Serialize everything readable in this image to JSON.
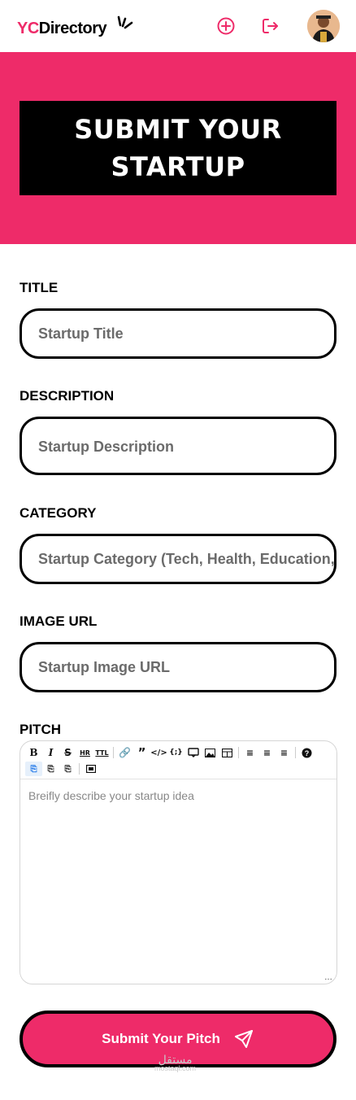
{
  "brand": {
    "yc": "YC",
    "directory": "Directory"
  },
  "colors": {
    "primary": "#EE2B69",
    "black": "#000000"
  },
  "nav": {
    "create_icon": "plus-circle-icon",
    "logout_icon": "logout-icon",
    "avatar": "user-avatar"
  },
  "hero": {
    "title": "Submit Your Startup"
  },
  "form": {
    "title": {
      "label": "Title",
      "placeholder": "Startup Title"
    },
    "description": {
      "label": "Description",
      "placeholder": "Startup Description"
    },
    "category": {
      "label": "Category",
      "placeholder": "Startup Category (Tech, Health, Education, etc.)"
    },
    "image": {
      "label": "Image URL",
      "placeholder": "Startup Image URL"
    },
    "pitch": {
      "label": "Pitch",
      "placeholder": "Breifly describe your startup idea"
    },
    "submit": "Submit Your Pitch"
  },
  "toolbar": {
    "row1": [
      "bold-icon",
      "italic-icon",
      "strikethrough-icon",
      "hr-icon",
      "title-icon",
      "link-icon",
      "quote-icon",
      "code-icon",
      "code-block-icon",
      "comment-icon",
      "image-icon",
      "table-icon",
      "unordered-list-icon",
      "ordered-list-icon",
      "checked-list-icon",
      "help-icon"
    ],
    "row2": [
      "edit-mode-icon",
      "live-mode-icon",
      "preview-mode-icon",
      "fullscreen-icon"
    ]
  },
  "watermark": {
    "line1": "مستقل",
    "line2": "mostaql.com"
  }
}
